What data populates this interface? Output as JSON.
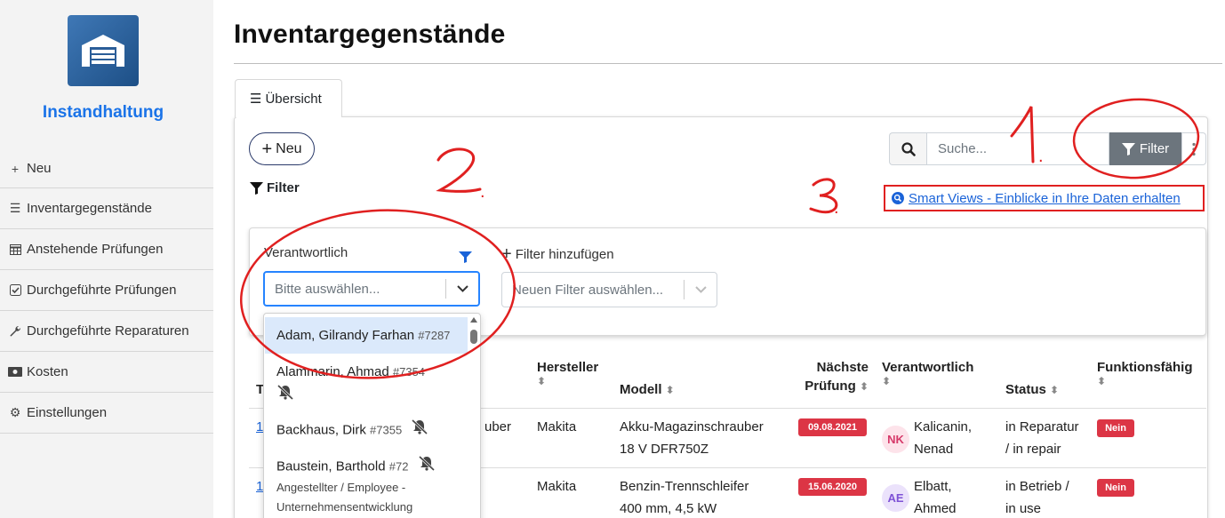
{
  "app": {
    "name": "Instandhaltung"
  },
  "sidebar": {
    "items": [
      {
        "icon": "plus-icon",
        "label": "Neu"
      },
      {
        "icon": "list-icon",
        "label": "Inventargegenstände"
      },
      {
        "icon": "calendar-icon",
        "label": "Anstehende Prüfungen"
      },
      {
        "icon": "checkbox-icon",
        "label": "Durchgeführte Prüfungen"
      },
      {
        "icon": "wrench-icon",
        "label": "Durchgeführte Reparaturen"
      },
      {
        "icon": "money-icon",
        "label": "Kosten"
      },
      {
        "icon": "gear-icon",
        "label": "Einstellungen"
      }
    ]
  },
  "page": {
    "title": "Inventargegenstände"
  },
  "tabs": [
    {
      "label": "Übersicht",
      "active": true
    }
  ],
  "toolbar": {
    "new_label": "Neu",
    "filter_heading": "Filter",
    "search_placeholder": "Suche...",
    "filter_button": "Filter",
    "smart_views_link": "Smart Views - Einblicke in Ihre Daten erhalten"
  },
  "filter_panel": {
    "responsible_label": "Verantwortlich",
    "responsible_placeholder": "Bitte auswählen...",
    "add_filter_label": "Filter hinzufügen",
    "new_filter_placeholder": "Neuen Filter auswählen..."
  },
  "dropdown": {
    "options": [
      {
        "name": "Adam, Gilrandy Farhan",
        "id": "#7287",
        "muted": false,
        "highlighted": true,
        "subtitle": ""
      },
      {
        "name": "Alammarin, Ahmad",
        "id": "#7354",
        "muted": true,
        "highlighted": false,
        "subtitle": ""
      },
      {
        "name": "Backhaus, Dirk",
        "id": "#7355",
        "muted": true,
        "highlighted": false,
        "subtitle": ""
      },
      {
        "name": "Baustein, Barthold",
        "id": "#72",
        "muted": true,
        "highlighted": false,
        "subtitle": "Angestellter / Employee - Unternehmensentwicklung"
      }
    ]
  },
  "table": {
    "columns": {
      "type": "T",
      "manufacturer": "Hersteller",
      "model": "Modell",
      "next_check_1": "Nächste",
      "next_check_2": "Prüfung",
      "responsible": "Verantwortlich",
      "status": "Status",
      "functional": "Funktionsfähig"
    },
    "rows": [
      {
        "link": "1",
        "type_tail": "uber",
        "manufacturer": "Makita",
        "model_1": "Akku-Magazinschrauber",
        "model_2": "18 V DFR750Z",
        "next_check": "09.08.2021",
        "initials": "NK",
        "resp_1": "Kalicanin,",
        "resp_2": "Nenad",
        "status_1": "in Reparatur",
        "status_2": "/ in repair",
        "functional": "Nein"
      },
      {
        "link": "1",
        "type_tail": "",
        "manufacturer": "Makita",
        "model_1": "Benzin-Trennschleifer",
        "model_2": "400 mm, 4,5 kW",
        "next_check": "15.06.2020",
        "initials": "AE",
        "resp_1": "Elbatt,",
        "resp_2": "Ahmed",
        "status_1": "in Betrieb /",
        "status_2": "in use",
        "functional": "Nein"
      }
    ]
  },
  "annotations": {
    "one": "1.",
    "two": "2.",
    "three": "3."
  },
  "colors": {
    "accent": "#1a73e8",
    "danger": "#dc3545",
    "annotation": "#e02020",
    "filter_button": "#6c757d"
  }
}
